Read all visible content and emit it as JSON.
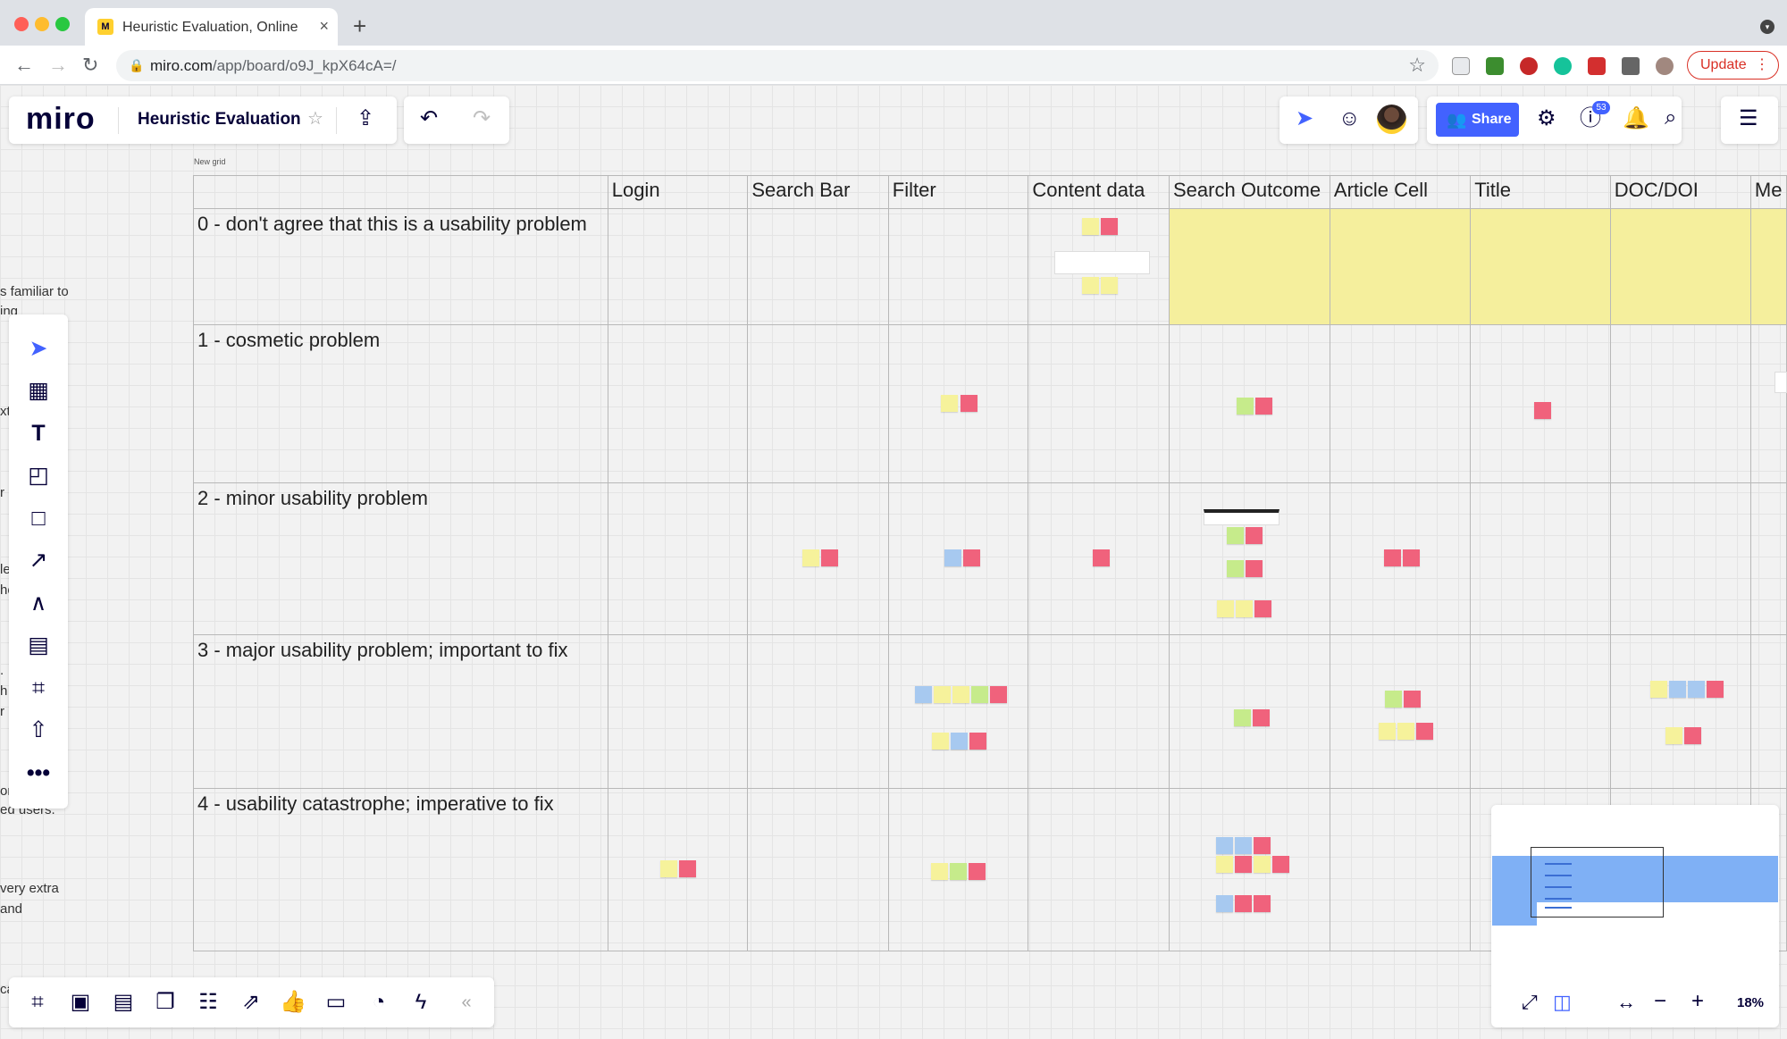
{
  "browser": {
    "tab_title": "Heuristic Evaluation, Online W",
    "url_domain": "miro.com",
    "url_path": "/app/board/o9J_kpX64cA=/",
    "update_label": "Update"
  },
  "app": {
    "logo": "miro",
    "board_title": "Heuristic Evaluation",
    "share_label": "Share",
    "notifications_count": "53",
    "zoom": "18%"
  },
  "grid": {
    "label": "New grid",
    "columns": [
      "Login",
      "Search Bar",
      "Filter",
      "Content data",
      "Search Outcome",
      "Article Cell",
      "Title",
      "DOC/DOI",
      "Me"
    ],
    "rows": [
      "0 - don't agree that this is a usability problem",
      "1 - cosmetic problem",
      "2 - minor usability problem",
      "3 - major usability problem; important to fix",
      "4 - usability catastrophe; imperative to fix"
    ]
  },
  "edge_text": [
    "s familiar to",
    "ing",
    "xt",
    "r",
    "le",
    "he",
    ".",
    "h",
    "r",
    "or",
    "ed users.",
    "very extra",
    " and",
    "ca"
  ],
  "colors": {
    "brand_blue": "#4262ff",
    "sticky_yellow": "#f6f29b",
    "sticky_red": "#f0627c",
    "sticky_green": "#c6eb8b",
    "sticky_blue": "#a7c9f0",
    "row_highlight": "#f5ef9d"
  },
  "icons": {
    "left_toolbar": [
      "select-icon",
      "templates-icon",
      "text-icon",
      "sticky-note-icon",
      "shape-icon",
      "connector-icon",
      "pen-icon",
      "comment-icon",
      "frame-icon",
      "upload-icon",
      "more-icon"
    ],
    "bottom_toolbar": [
      "frames-icon",
      "presentation-icon",
      "comments-icon",
      "chat-icon",
      "cards-icon",
      "share-screen-icon",
      "voting-icon",
      "video-call-icon",
      "timer-icon",
      "lightning-icon",
      "collapse-icon"
    ]
  }
}
